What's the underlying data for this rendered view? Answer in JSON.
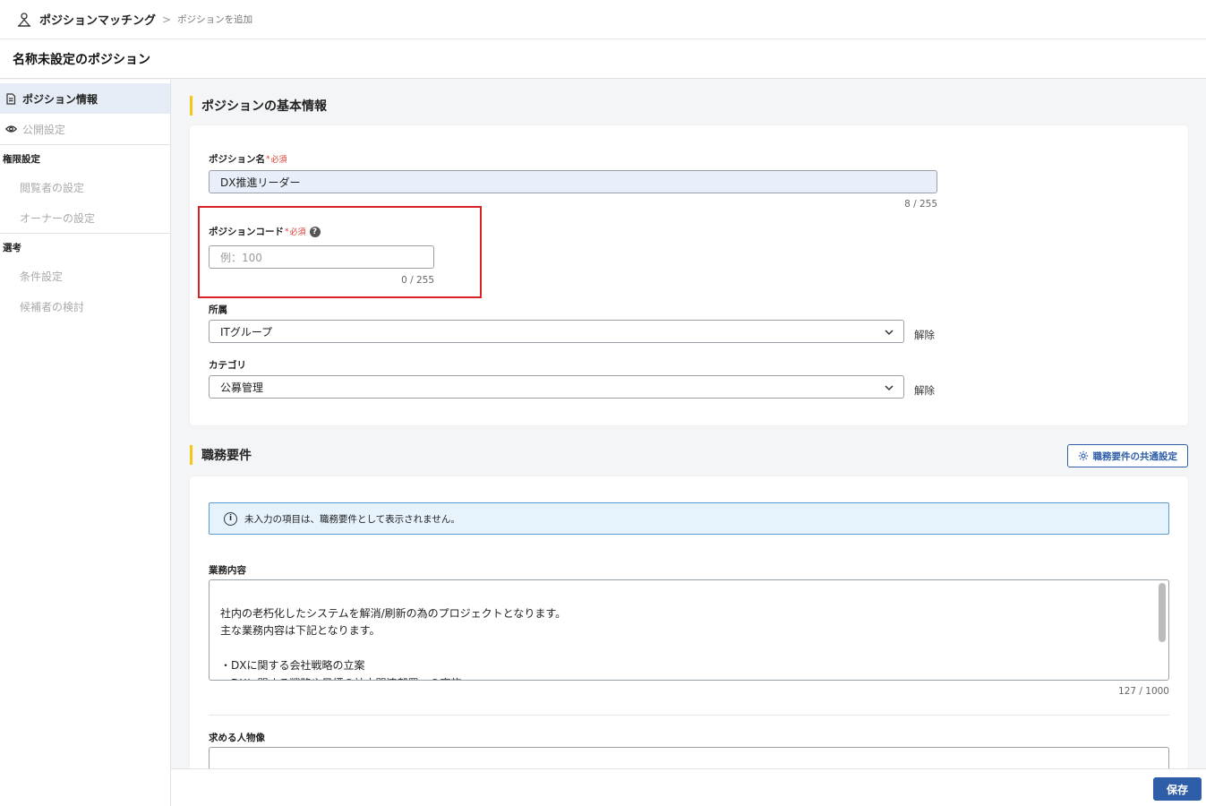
{
  "breadcrumb": {
    "app": "ポジションマッチング",
    "separator": ">",
    "current": "ポジションを追加"
  },
  "page_title": "名称未設定のポジション",
  "sidebar": {
    "items": [
      {
        "label": "ポジション情報",
        "icon": "document-icon",
        "active": true
      },
      {
        "label": "公開設定",
        "icon": "eye-icon",
        "active": false
      }
    ],
    "groups": [
      {
        "heading": "権限設定",
        "items": [
          "閲覧者の設定",
          "オーナーの設定"
        ]
      },
      {
        "heading": "選考",
        "items": [
          "条件設定",
          "候補者の検討"
        ]
      }
    ]
  },
  "basic_info": {
    "section_title": "ポジションの基本情報",
    "position_name": {
      "label": "ポジション名",
      "required_mark": "*",
      "required_text": "必須",
      "value": "DX推進リーダー",
      "counter": "8 / 255"
    },
    "position_code": {
      "label": "ポジションコード",
      "required_mark": "*",
      "required_text": "必須",
      "help": "?",
      "placeholder": "例：100",
      "counter": "0 / 255"
    },
    "affiliation": {
      "label": "所属",
      "value": "ITグループ",
      "clear": "解除"
    },
    "category": {
      "label": "カテゴリ",
      "value": "公募管理",
      "clear": "解除"
    }
  },
  "job_requirements": {
    "section_title": "職務要件",
    "common_settings_button": "職務要件の共通設定",
    "info_text": "未入力の項目は、職務要件として表示されません。",
    "job_content": {
      "label": "業務内容",
      "value": "社内の老朽化したシステムを解消/刷新の為のプロジェクトとなります。\n主な業務内容は下記となります。\n\n・DXに関する会社戦略の立案\n・DXに関する戦略や目標の社内関連部署への実施",
      "counter": "127 / 1000"
    },
    "ideal_candidate": {
      "label": "求める人物像"
    }
  },
  "footer": {
    "save_label": "保存"
  },
  "colors": {
    "accent": "#2f5ea8",
    "section_bar": "#f5c518",
    "highlight": "#d92128",
    "required": "#e03a2e"
  }
}
